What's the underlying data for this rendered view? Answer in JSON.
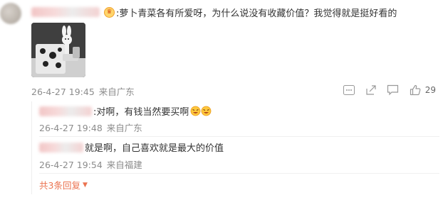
{
  "comment": {
    "text": ":萝卜青菜各有所爱呀，为什么说没有收藏价值？我觉得就是挺好看的",
    "timestamp": "26-4-27 19:45",
    "location": "来自广东",
    "like_count": "29",
    "image_icon": "figurine-photo",
    "badge_icon": "crown-badge-icon"
  },
  "replies": [
    {
      "text": ":对啊，有钱当然要买啊",
      "timestamp": "26-4-27 19:48",
      "location": "来自广东",
      "emoji": "crying-laughing"
    },
    {
      "text": "就是啊，自己喜欢就是最大的价值",
      "timestamp": "26-4-27 19:54",
      "location": "来自福建"
    }
  ],
  "more_replies": "共3条回复",
  "colors": {
    "accent": "#eb7350",
    "meta": "#8c8c8c",
    "text": "#333333"
  }
}
